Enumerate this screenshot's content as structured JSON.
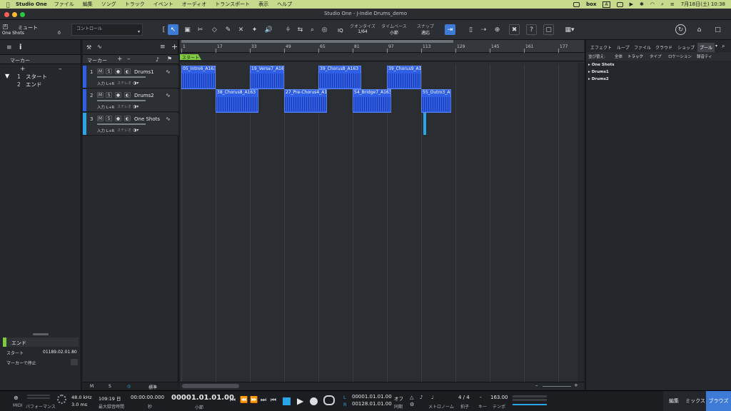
{
  "menubar": {
    "app": "Studio One",
    "items": [
      "ファイル",
      "編集",
      "ソング",
      "トラック",
      "イベント",
      "オーディオ",
      "トランスポート",
      "表示",
      "ヘルプ"
    ],
    "box_label": "box",
    "a_label": "A",
    "datetime": "7月18日(土) 10:38"
  },
  "window": {
    "title": "Studio One - J-Indie Drums_demo"
  },
  "toolbar": {
    "mute_label": "ミュート",
    "oneshots_label": "One Shots",
    "control_label": "コントロール",
    "control_value": "0",
    "quantize_label": "クオンタイズ",
    "quantize_value": "1/64",
    "timebase_label": "タイムベース",
    "timebase_value": "小節",
    "snap_label": "スナップ",
    "snap_value": "適応",
    "iq_label": "IQ"
  },
  "inspector": {
    "marker_title": "マーカー",
    "markers": [
      {
        "num": "1",
        "name": "スタート"
      },
      {
        "num": "2",
        "name": "エンド"
      }
    ],
    "end_label": "エンド",
    "start_label": "スタート",
    "start_value": "01189.02.01.80",
    "stop_label": "マーカーで停止"
  },
  "tracklist": {
    "marker_label": "マーカー",
    "tracks": [
      {
        "num": "1",
        "name": "Drums1",
        "io": "入力 L+R",
        "mode": "ステレオ",
        "color": "#2f5fe6"
      },
      {
        "num": "2",
        "name": "Drums2",
        "io": "入力 L+R",
        "mode": "ステレオ",
        "color": "#2f5fe6"
      },
      {
        "num": "3",
        "name": "One Shots",
        "io": "入力 L+R",
        "mode": "ステレオ",
        "color": "#2aa6e8"
      }
    ],
    "bottom": [
      "M",
      "S",
      "標準"
    ]
  },
  "arrange": {
    "ruler_ticks": [
      "1",
      "17",
      "33",
      "49",
      "65",
      "81",
      "97",
      "113",
      "129",
      "145",
      "161",
      "177"
    ],
    "start_marker": "スタート",
    "clips": [
      {
        "track": 0,
        "start": 1,
        "end": 17,
        "name": "05_Intro6_A163"
      },
      {
        "track": 0,
        "start": 33,
        "end": 49,
        "name": "19_Verse7_A163"
      },
      {
        "track": 0,
        "start": 65,
        "end": 85,
        "name": "39_Chorus8_A163"
      },
      {
        "track": 0,
        "start": 97,
        "end": 113,
        "name": "39_Chorus9_A163"
      },
      {
        "track": 1,
        "start": 17,
        "end": 37,
        "name": "38_Chorus8_A163"
      },
      {
        "track": 1,
        "start": 49,
        "end": 69,
        "name": "27_Pre-Chorus4_A163"
      },
      {
        "track": 1,
        "start": 81,
        "end": 99,
        "name": "54_Bridge7_A163"
      },
      {
        "track": 1,
        "start": 113,
        "end": 127,
        "name": "55_Outro3_A163"
      }
    ],
    "oneshot_bar": 114
  },
  "browser": {
    "tabs": [
      "エフェクト",
      "ループ",
      "ファイル",
      "クラウド",
      "ショップ",
      "プール"
    ],
    "sort_label": "並び替え:",
    "sort_options": [
      "全体",
      "トラック",
      "タイプ",
      "ロケーション",
      "録音ティ"
    ],
    "items": [
      "One Shots",
      "Drums1",
      "Drums2"
    ]
  },
  "transport": {
    "midi_label": "MIDI",
    "perf_label": "パフォーマンス",
    "samplerate": "48.0 kHz",
    "latency": "3.0 ms",
    "days": "109:19 日",
    "days_label": "最大録音時間",
    "seconds": "00:00:00.000",
    "seconds_label": "秒",
    "position": "00001.01.01.00",
    "position_label": "小節",
    "loop_l": "00001.01.01.00",
    "loop_r": "00128.01.01.00",
    "off_label": "オフ",
    "sync_label": "同期",
    "metronome_label": "メトロノーム",
    "timesig": "4 / 4",
    "timesig_label": "拍子",
    "key_label": "キー",
    "key_value": "-",
    "tempo": "163.00",
    "tempo_label": "テンポ",
    "edit_label": "編集",
    "mix_label": "ミックス",
    "browse_label": "ブラウズ"
  }
}
